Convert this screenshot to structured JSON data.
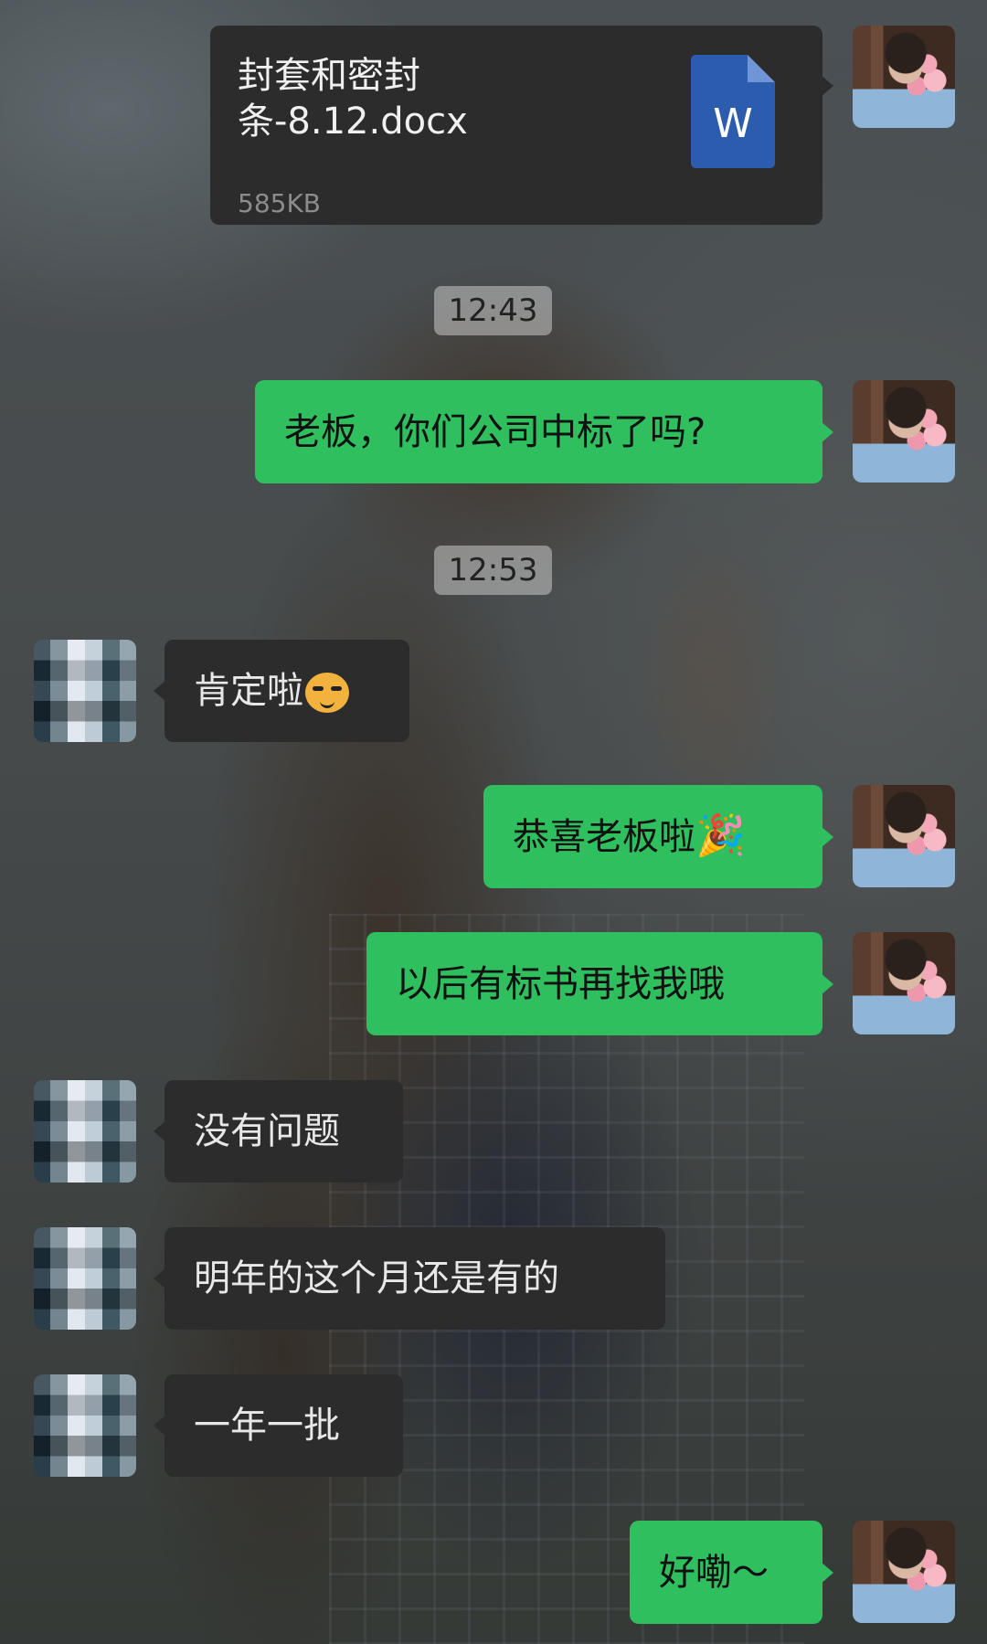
{
  "messages": {
    "file": {
      "title": "封套和密封条-8.12.docx",
      "size": "585KB",
      "icon": "word-doc-icon",
      "icon_letter": "W"
    },
    "time1": "12:43",
    "m1": "老板，你们公司中标了吗?",
    "time2": "12:53",
    "m2": "肯定啦",
    "m3": "恭喜老板啦",
    "m4": "以后有标书再找我哦",
    "m5": "没有问题",
    "m6": "明年的这个月还是有的",
    "m7": "一年一批",
    "m8": "好嘞～"
  },
  "colors": {
    "sent_bubble": "#2fbf5f",
    "received_bubble": "#2c2c2c",
    "word_blue": "#2b5cad"
  }
}
